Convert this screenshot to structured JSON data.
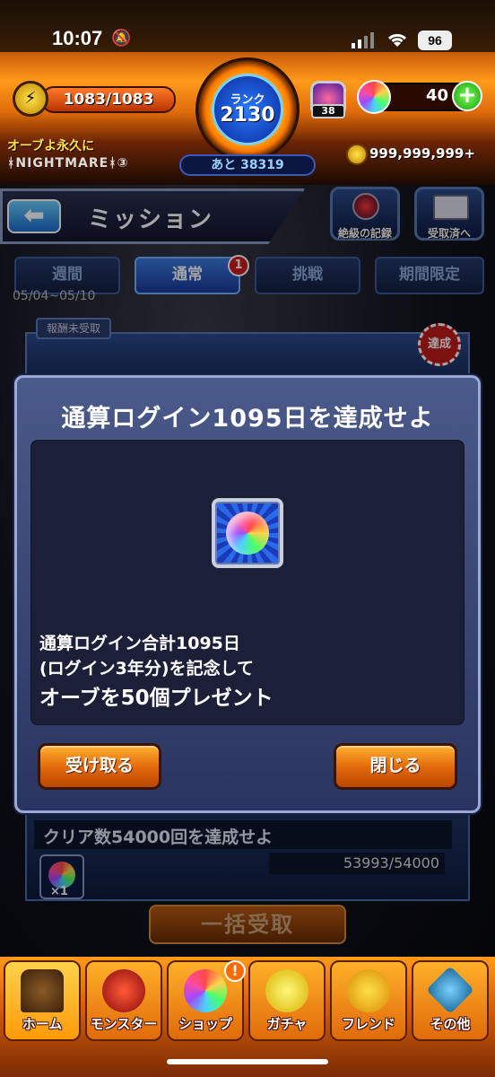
{
  "status_bar": {
    "time": "10:07",
    "battery": "96"
  },
  "header": {
    "stamina": "1083/1083",
    "rank_label": "ランク",
    "rank_value": "2130",
    "exp_to_next": "あと 38319",
    "luck_badge": "38",
    "orb_count": "40",
    "player_name": "オーブよ永久に",
    "player_title": "ᚼNIGHTMAREᚼ③",
    "coins": "999,999,999+"
  },
  "screen": {
    "title": "ミッション",
    "record_button": "絶級の記録",
    "received_button": "受取済へ"
  },
  "tabs": [
    {
      "label": "週間"
    },
    {
      "label": "通常",
      "badge": "1"
    },
    {
      "label": "挑戦"
    },
    {
      "label": "期間限定"
    }
  ],
  "date_range": "05/04~05/10",
  "unclaimed_label": "報酬未受取",
  "achieved_stamp": "達成",
  "dialog": {
    "title": "通算ログイン1095日を達成せよ",
    "desc_line1": "通算ログイン合計1095日",
    "desc_line2": "(ログイン3年分)を記念して",
    "desc_line3": "オーブを50個プレゼント",
    "receive_button": "受け取る",
    "close_button": "閉じる"
  },
  "mission_card": {
    "title": "クリア数54000回を達成せよ",
    "progress": "53993/54000",
    "reward_qty": "×1"
  },
  "claim_all_button": "一括受取",
  "nav": {
    "home": "ホーム",
    "monster": "モンスター",
    "shop": "ショップ",
    "gacha": "ガチャ",
    "friend": "フレンド",
    "other": "その他",
    "shop_badge": "!"
  }
}
